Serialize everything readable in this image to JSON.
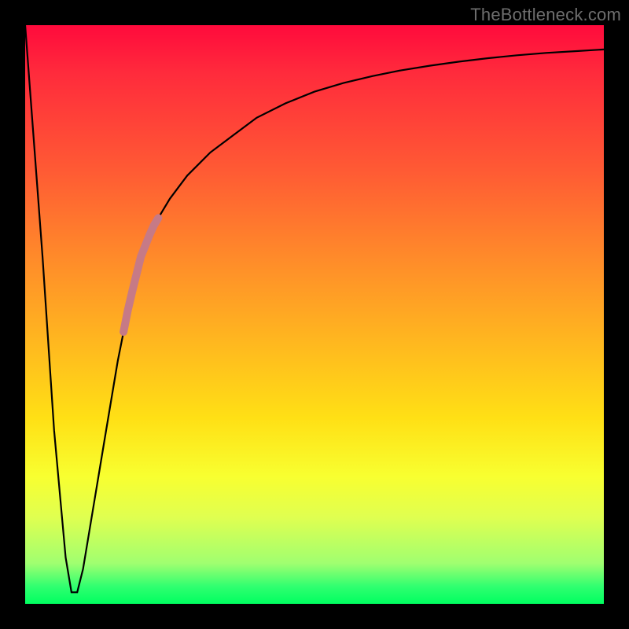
{
  "watermark": "TheBottleneck.com",
  "chart_data": {
    "type": "line",
    "title": "",
    "xlabel": "",
    "ylabel": "",
    "xlim": [
      0,
      100
    ],
    "ylim": [
      0,
      100
    ],
    "grid": false,
    "series": [
      {
        "name": "bottleneck-curve",
        "x": [
          0,
          3,
          5,
          7,
          8,
          9,
          10,
          12,
          14,
          16,
          18,
          20,
          22,
          25,
          28,
          32,
          36,
          40,
          45,
          50,
          55,
          60,
          65,
          70,
          75,
          80,
          85,
          90,
          95,
          100
        ],
        "y": [
          100,
          60,
          30,
          8,
          2,
          2,
          6,
          18,
          30,
          42,
          52,
          60,
          65,
          70,
          74,
          78,
          81,
          84,
          86.5,
          88.5,
          90,
          91.2,
          92.2,
          93,
          93.7,
          94.3,
          94.8,
          95.2,
          95.5,
          95.8
        ]
      }
    ],
    "highlight": {
      "name": "current-config-marker",
      "color": "#c67a86",
      "x_range": [
        17,
        23
      ],
      "note": "thick segment overlaid on rising part of curve"
    }
  }
}
